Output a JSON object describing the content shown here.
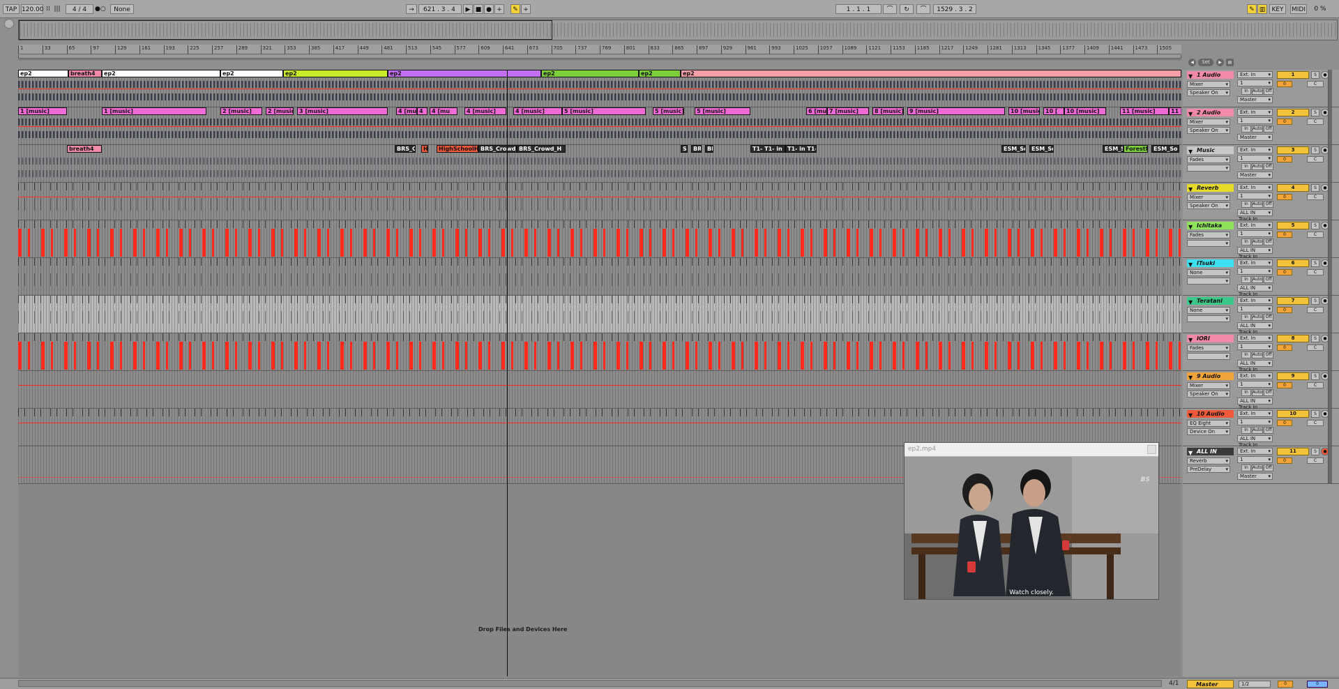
{
  "transport": {
    "tap_label": "TAP",
    "tempo": "120.00",
    "time_sig_num": "4",
    "time_sig_sep": "/",
    "time_sig_den": "4",
    "quantize": "None",
    "position_bar": "621",
    "position_beat": "3",
    "position_sixteenth": "4",
    "loop_start_bar": "1",
    "loop_start_beat": "1",
    "loop_start_sixteenth": "1",
    "loop_length_bar": "1529",
    "loop_length_beat": "3",
    "loop_length_sixteenth": "2",
    "key_label": "KEY",
    "midi_label": "MIDI",
    "cpu_readout": "0 %"
  },
  "ruler": {
    "ticks": [
      "1",
      "33",
      "65",
      "97",
      "129",
      "161",
      "193",
      "225",
      "257",
      "289",
      "321",
      "353",
      "385",
      "417",
      "449",
      "481",
      "513",
      "545",
      "577",
      "609",
      "641",
      "673",
      "705",
      "737",
      "769",
      "801",
      "833",
      "865",
      "897",
      "929",
      "961",
      "993",
      "1025",
      "1057",
      "1089",
      "1121",
      "1153",
      "1185",
      "1217",
      "1249",
      "1281",
      "1313",
      "1345",
      "1377",
      "1409",
      "1441",
      "1473",
      "1505"
    ]
  },
  "set_label": "Set",
  "lanes": [
    {
      "name": "1 Audio",
      "color": "#f08aa8",
      "clips": [
        [
          "ep2",
          "#ffffff",
          0,
          72
        ],
        [
          "breath4",
          "#f08aa8",
          72,
          48
        ],
        [
          "ep2",
          "#ffffff",
          120,
          170
        ],
        [
          "ep2",
          "#ffffff",
          290,
          90
        ],
        [
          "ep2",
          "#c8ec2a",
          380,
          150
        ],
        [
          "ep2",
          "#c070f0",
          530,
          220
        ],
        [
          "ep2",
          "#7ccf3a",
          750,
          140
        ],
        [
          "ep2",
          "#7ccf3a",
          890,
          60
        ],
        [
          "ep2",
          "#f5a0a8",
          950,
          718
        ]
      ],
      "input": "Ext. In",
      "monitor": "Mixer",
      "device": "Speaker On",
      "route": "Master",
      "num": "1",
      "vol": "0",
      "arm_on": false,
      "track_in": ""
    },
    {
      "name": "2 Audio",
      "color": "#f08aa8",
      "clips": [
        [
          "1 [music]",
          "#f26ad6",
          0,
          70
        ],
        [
          "1 [music]",
          "#f26ad6",
          120,
          150
        ],
        [
          "2 [music]",
          "#f26ad6",
          290,
          60
        ],
        [
          "2 [music]",
          "#f26ad6",
          355,
          40
        ],
        [
          "3 [music]",
          "#f26ad6",
          400,
          130
        ],
        [
          "4 [music",
          "#f26ad6",
          542,
          30
        ],
        [
          "4",
          "#f26ad6",
          572,
          15
        ],
        [
          "4 [mu",
          "#f26ad6",
          590,
          40
        ],
        [
          "4 [music]",
          "#f26ad6",
          640,
          60
        ],
        [
          "4 [music]",
          "#f26ad6",
          710,
          70
        ],
        [
          "5 [music]",
          "#f26ad6",
          780,
          120
        ],
        [
          "5 [music]",
          "#f26ad6",
          910,
          45
        ],
        [
          "5 [music]",
          "#f26ad6",
          970,
          80
        ],
        [
          "6 [mu",
          "#f26ad6",
          1130,
          30
        ],
        [
          "7 [music]",
          "#f26ad6",
          1160,
          60
        ],
        [
          "8 [music]",
          "#f26ad6",
          1225,
          45
        ],
        [
          "9 [music]",
          "#f26ad6",
          1275,
          140
        ],
        [
          "10 [music]",
          "#f26ad6",
          1420,
          45
        ],
        [
          "10 [",
          "#f26ad6",
          1470,
          30
        ],
        [
          "10 [music]",
          "#f26ad6",
          1500,
          60
        ],
        [
          "11 [music]",
          "#f26ad6",
          1580,
          70
        ],
        [
          "11 [music]",
          "#f26ad6",
          1650,
          30
        ]
      ],
      "input": "Ext. In",
      "monitor": "Mixer",
      "device": "Speaker On",
      "route": "Master",
      "num": "2",
      "vol": "0",
      "arm_on": false,
      "track_in": ""
    },
    {
      "name": "Music",
      "color": "#c9c9c9",
      "clips": [
        [
          "breath4",
          "#f08aa8",
          70,
          50
        ],
        [
          "BRS_C",
          "#2a2a2a",
          540,
          30
        ],
        [
          "H",
          "#f05a3a",
          578,
          10
        ],
        [
          "HighSchoolHa",
          "#f05a3a",
          600,
          60
        ],
        [
          "BRS_Crowd_H",
          "#2a2a2a",
          660,
          55
        ],
        [
          "BRS_Crowd_H",
          "#2a2a2a",
          715,
          70
        ],
        [
          "S",
          "#2a2a2a",
          950,
          10
        ],
        [
          "BR",
          "#2a2a2a",
          965,
          15
        ],
        [
          "BR",
          "#2a2a2a",
          985,
          12
        ],
        [
          "T1- T1- in",
          "#2a2a2a",
          1050,
          50
        ],
        [
          "T1- in T1-",
          "#2a2a2a",
          1100,
          45
        ],
        [
          "ESM_So",
          "#2a2a2a",
          1410,
          35
        ],
        [
          "ESM_So",
          "#2a2a2a",
          1450,
          35
        ],
        [
          "ESM_S",
          "#2a2a2a",
          1555,
          30
        ],
        [
          "ForestMe",
          "#7ccf3a",
          1585,
          35
        ],
        [
          "ESM_So",
          "#2a2a2a",
          1625,
          40
        ]
      ],
      "input": "Ext. In",
      "monitor": "Fades",
      "device": "",
      "route": "Master",
      "num": "3",
      "vol": "0",
      "arm_on": false,
      "track_in": ""
    },
    {
      "name": "Reverb",
      "color": "#e8dc2a",
      "clips": [],
      "input": "Ext. In",
      "monitor": "Mixer",
      "device": "Speaker On",
      "route": "ALL IN",
      "num": "4",
      "vol": "0",
      "arm_on": false,
      "track_in": "Track In"
    },
    {
      "name": "Ichitaka",
      "color": "#8ee35a",
      "clips": [],
      "input": "Ext. In",
      "monitor": "Fades",
      "device": "",
      "route": "ALL IN",
      "num": "5",
      "vol": "0",
      "arm_on": false,
      "track_in": "Track In"
    },
    {
      "name": "ITsuki",
      "color": "#3ee0ef",
      "clips": [],
      "input": "Ext. In",
      "monitor": "None",
      "device": "",
      "route": "ALL IN",
      "num": "6",
      "vol": "0",
      "arm_on": false,
      "track_in": "Track In"
    },
    {
      "name": "Teratani",
      "color": "#3ac98a",
      "clips": [],
      "input": "Ext. In",
      "monitor": "None",
      "device": "",
      "route": "ALL IN",
      "num": "7",
      "vol": "0",
      "arm_on": false,
      "track_in": "Track In"
    },
    {
      "name": "IORI",
      "color": "#f08aa8",
      "clips": [],
      "input": "Ext. In",
      "monitor": "Fades",
      "device": "",
      "route": "ALL IN",
      "num": "8",
      "vol": "0",
      "arm_on": false,
      "track_in": "Track In"
    },
    {
      "name": "9 Audio",
      "color": "#f2a33a",
      "clips": [],
      "input": "Ext. In",
      "monitor": "Mixer",
      "device": "Speaker On",
      "route": "ALL IN",
      "num": "9",
      "vol": "0",
      "arm_on": false,
      "track_in": "Track In"
    },
    {
      "name": "10 Audio",
      "color": "#f05a3a",
      "clips": [],
      "input": "Ext. In",
      "monitor": "EQ Eight",
      "device": "Device On",
      "route": "ALL IN",
      "num": "10",
      "vol": "0",
      "arm_on": false,
      "track_in": "Track In"
    },
    {
      "name": "ALL IN",
      "color": "#3a3a3a",
      "clips": [],
      "input": "Ext. In",
      "monitor": "Reverb",
      "device": "PreDelay",
      "route": "Master",
      "num": "11",
      "vol": "0",
      "arm_on": true,
      "track_in": ""
    }
  ],
  "mixer_labels": {
    "s": "S",
    "c": "C",
    "in": "In",
    "auto": "Auto",
    "off": "Off",
    "channel": "1"
  },
  "drop_label": "Drop Files and Devices Here",
  "video": {
    "title": "ep2.mp4",
    "caption": "Watch closely.",
    "logo": "BS"
  },
  "bottom": {
    "zoom": "4/1",
    "master_name": "Master",
    "master_input": "1/2",
    "master_vol": "0",
    "master_cue": "0"
  },
  "colors": {
    "accent": "#f2c23a",
    "automation": "#ff2a1a",
    "orange": "#f2a33a"
  }
}
